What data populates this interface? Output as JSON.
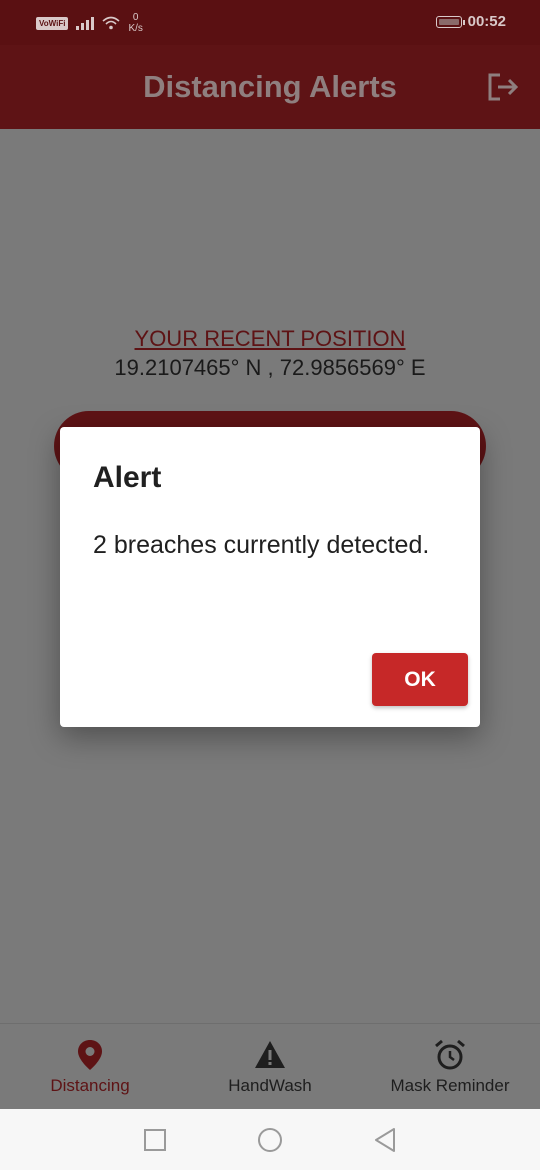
{
  "status_bar": {
    "wifi_calling_badge": "VoWiFi",
    "net_speed_value": "0",
    "net_speed_unit": "K/s",
    "time": "00:52"
  },
  "app_bar": {
    "title": "Distancing Alerts",
    "logout_icon": "logout-icon"
  },
  "content": {
    "position_title": "YOUR RECENT POSITION",
    "position_value": "19.2107465° N , 72.9856569° E"
  },
  "dialog": {
    "title": "Alert",
    "message": "2 breaches currently detected.",
    "ok_label": "OK"
  },
  "bottom_nav": {
    "items": [
      {
        "label": "Distancing",
        "icon": "location-pin-icon",
        "active": true
      },
      {
        "label": "HandWash",
        "icon": "warning-icon",
        "active": false
      },
      {
        "label": "Mask Reminder",
        "icon": "alarm-clock-icon",
        "active": false
      }
    ]
  },
  "system_nav": {
    "recents_icon": "square-icon",
    "home_icon": "circle-icon",
    "back_icon": "triangle-back-icon"
  },
  "colors": {
    "primary": "#5e1315",
    "accent": "#c62828",
    "scrim": "#7a7a7a"
  }
}
